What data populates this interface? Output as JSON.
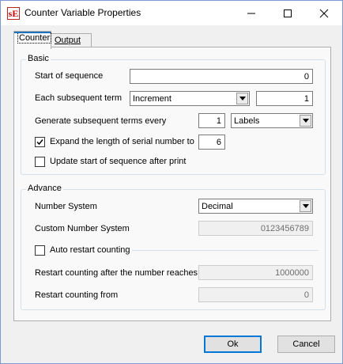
{
  "window": {
    "app_icon_text": "sE",
    "title": "Counter Variable Properties",
    "minimize_label": "minimize",
    "maximize_label": "maximize",
    "close_label": "close"
  },
  "tabs": [
    {
      "label": "Counter",
      "active": true
    },
    {
      "label": "Output",
      "active": false
    }
  ],
  "basic": {
    "group_title": "Basic",
    "start_label": "Start of sequence",
    "start_value": "0",
    "each_label": "Each subsequent term",
    "each_mode": "Increment",
    "each_value": "1",
    "generate_label": "Generate subsequent terms every",
    "generate_value": "1",
    "generate_unit": "Labels",
    "expand_label": "Expand the length of serial number to",
    "expand_checked": true,
    "expand_value": "6",
    "update_label": "Update start of sequence after print",
    "update_checked": false
  },
  "advance": {
    "group_title": "Advance",
    "number_system_label": "Number System",
    "number_system_value": "Decimal",
    "custom_label": "Custom Number System",
    "custom_value": "0123456789",
    "auto_restart_label": "Auto restart counting",
    "auto_restart_checked": false,
    "restart_after_label": "Restart counting after the number reaches",
    "restart_after_value": "1000000",
    "restart_from_label": "Restart counting from",
    "restart_from_value": "0"
  },
  "buttons": {
    "ok": "Ok",
    "cancel": "Cancel"
  }
}
